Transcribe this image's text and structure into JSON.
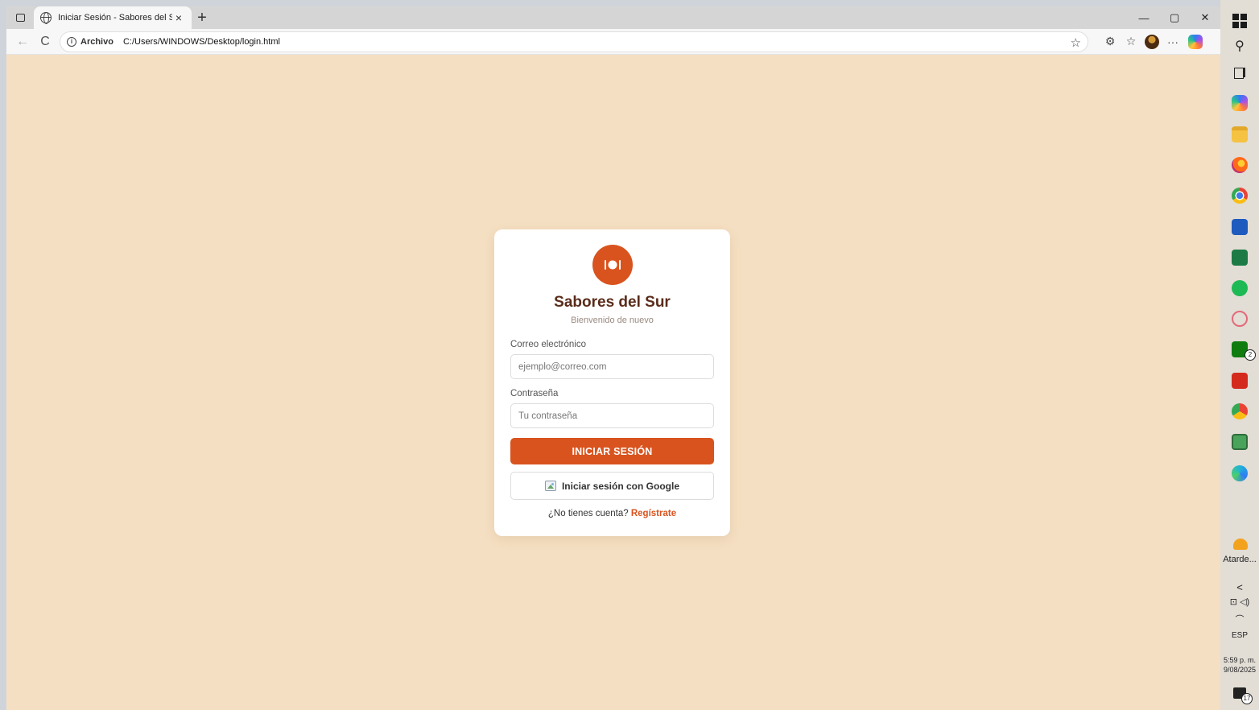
{
  "browser": {
    "tab_title": "Iniciar Sesión - Sabores del Sur",
    "tab_close": "×",
    "new_tab": "+",
    "window_controls": {
      "minimize": "—",
      "restore": "▢",
      "close": "✕"
    },
    "nav": {
      "back": "←",
      "reload": "C"
    },
    "address": {
      "scheme_label": "Archivo",
      "url": "C:/Users/WINDOWS/Desktop/login.html"
    },
    "toolbar_more": "···"
  },
  "login": {
    "brand_title": "Sabores del Sur",
    "brand_subtitle": "Bienvenido de nuevo",
    "email_label": "Correo electrónico",
    "email_placeholder": "ejemplo@correo.com",
    "email_value": "",
    "password_label": "Contraseña",
    "password_placeholder": "Tu contraseña",
    "password_value": "",
    "submit_label": "INICIAR SESIÓN",
    "google_label": "Iniciar sesión con Google",
    "signup_prompt": "¿No tienes cuenta?",
    "signup_link": "Regístrate",
    "colors": {
      "accent": "#d9531e",
      "page_bg": "#f5dfc2",
      "title": "#5a2c1a"
    }
  },
  "taskbar": {
    "weather_label": "Atarde...",
    "badge_count": "2",
    "language": "ESP",
    "time": "5:59 p. m.",
    "date": "9/08/2025",
    "notification_count": "17",
    "apps": [
      "copilot",
      "file-explorer",
      "firefox",
      "chrome",
      "word",
      "excel",
      "spotify",
      "snipping-tool",
      "xbox",
      "acrobat",
      "chrome-profile",
      "remote-desktop",
      "edge"
    ]
  }
}
